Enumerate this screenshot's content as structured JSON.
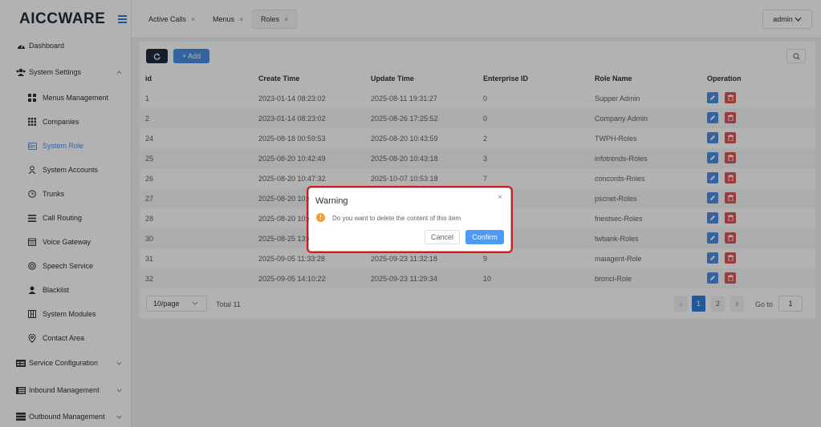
{
  "app": {
    "logo": "AICCWARE"
  },
  "sidebar": {
    "items": [
      {
        "label": "Dashboard",
        "icon": "dashboard-icon"
      },
      {
        "label": "System Settings",
        "icon": "users-icon"
      },
      {
        "label": "Menus Management",
        "icon": "grid-icon"
      },
      {
        "label": "Companies",
        "icon": "grid-icon"
      },
      {
        "label": "System Role",
        "icon": "id-card-icon"
      },
      {
        "label": "System Accounts",
        "icon": "user-icon"
      },
      {
        "label": "Trunks",
        "icon": "clock-icon"
      },
      {
        "label": "Call Routing",
        "icon": "list-icon"
      },
      {
        "label": "Voice Gateway",
        "icon": "calendar-icon"
      },
      {
        "label": "Speech Service",
        "icon": "chat-icon"
      },
      {
        "label": "Blacklist",
        "icon": "user-icon"
      },
      {
        "label": "System Modules",
        "icon": "module-icon"
      },
      {
        "label": "Contact Area",
        "icon": "location-icon"
      },
      {
        "label": "Service Configuration",
        "icon": "table-icon"
      },
      {
        "label": "Inbound Management",
        "icon": "list-icon"
      },
      {
        "label": "Outbound Management",
        "icon": "list-icon"
      }
    ]
  },
  "tabs": [
    {
      "label": "Active Calls",
      "close": "×"
    },
    {
      "label": "Menus",
      "close": "×"
    },
    {
      "label": "Roles",
      "close": "×"
    }
  ],
  "header": {
    "user": "admin"
  },
  "toolbar": {
    "add_label": "+ Add"
  },
  "table": {
    "columns": [
      "id",
      "Create Time",
      "Update Time",
      "Enterprise ID",
      "Role Name",
      "Operation"
    ],
    "rows": [
      [
        "1",
        "2023-01-14 08:23:02",
        "2025-08-11 19:31:27",
        "0",
        "Supper Admin"
      ],
      [
        "2",
        "2023-01-14 08:23:02",
        "2025-08-26 17:25:52",
        "0",
        "Company Admin"
      ],
      [
        "24",
        "2025-08-18 00:59:53",
        "2025-08-20 10:43:59",
        "2",
        "TWPH-Roles"
      ],
      [
        "25",
        "2025-08-20 10:42:49",
        "2025-08-20 10:43:18",
        "3",
        "infotrends-Roles"
      ],
      [
        "26",
        "2025-08-20 10:47:32",
        "2025-10-07 10:53:18",
        "7",
        "concords-Roles"
      ],
      [
        "27",
        "2025-08-20 10:4",
        "",
        "",
        "pscnet-Roles"
      ],
      [
        "28",
        "2025-08-20 10:4",
        "",
        "",
        "friestsec-Roles"
      ],
      [
        "30",
        "2025-08-25 13:4",
        "",
        "",
        "twbank-Roles"
      ],
      [
        "31",
        "2025-09-05 11:33:28",
        "2025-09-23 11:32:18",
        "9",
        "maiagent-Role"
      ],
      [
        "32",
        "2025-09-05 14:10:22",
        "2025-09-23 11:29:34",
        "10",
        "bronci-Role"
      ]
    ]
  },
  "pagination": {
    "page_size": "10/page",
    "total": "Total 11",
    "pages": [
      "1",
      "2"
    ],
    "current_page": "1",
    "goto_label": "Go to",
    "goto_value": "1"
  },
  "dialog": {
    "title": "Warning",
    "message": "Do you want to delete the content of this item",
    "cancel_label": "Cancel",
    "confirm_label": "Confirm",
    "close": "×",
    "warn_glyph": "!"
  },
  "colors": {
    "primary": "#4c8ee6",
    "danger": "#e05555",
    "warning": "#e6a23c",
    "highlight": "#d9181d"
  }
}
